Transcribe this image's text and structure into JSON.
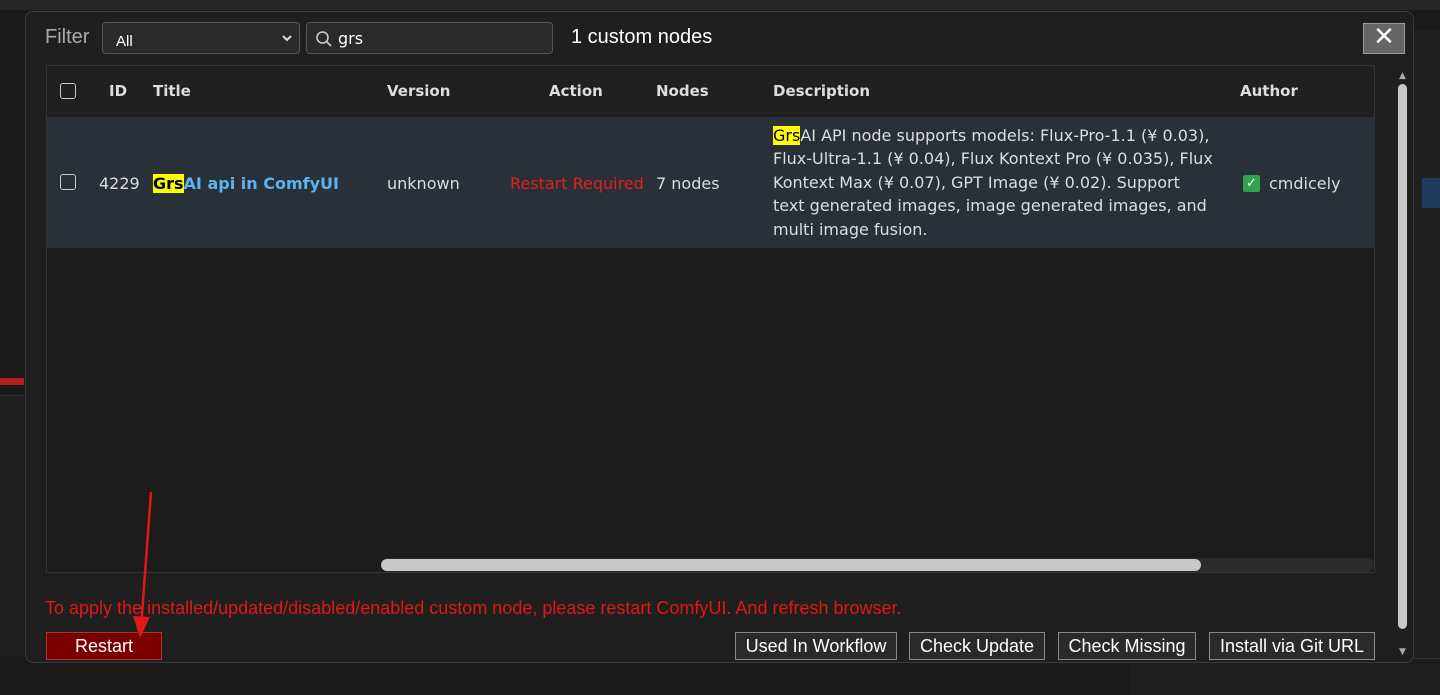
{
  "filter": {
    "label": "Filter",
    "selected": "All"
  },
  "search": {
    "value": "grs"
  },
  "result_count": "1 custom nodes",
  "close_label": "✕",
  "table": {
    "headers": {
      "id": "ID",
      "title": "Title",
      "version": "Version",
      "action": "Action",
      "nodes": "Nodes",
      "description": "Description",
      "author": "Author"
    },
    "rows": [
      {
        "id": "4229",
        "title_highlight": "Grs",
        "title_rest": "AI api in ComfyUI",
        "version": "unknown",
        "action": "Restart Required",
        "nodes": "7 nodes",
        "description_highlight": "Grs",
        "description_rest": "AI API node supports models: Flux-Pro-1.1 (¥ 0.03), Flux-Ultra-1.1 (¥ 0.04), Flux Kontext Pro (¥ 0.035), Flux Kontext Max (¥ 0.07), GPT Image (¥ 0.02). Support text generated images, image generated images, and multi image fusion.",
        "author": "cmdicely"
      }
    ]
  },
  "notice": "To apply the installed/updated/disabled/enabled custom node, please restart ComfyUI. And refresh browser.",
  "buttons": {
    "restart": "Restart",
    "used_in_workflow": "Used In Workflow",
    "check_update": "Check Update",
    "check_missing": "Check Missing",
    "install_git": "Install via Git URL"
  },
  "colors": {
    "highlight": "#ffff00",
    "title_link": "#5bb3f0",
    "restart_required": "#e02020",
    "notice": "#e01818",
    "restart_button": "#7a0000",
    "author_check": "#2ea44f"
  },
  "icons": {
    "search": "search-icon",
    "close": "close-icon",
    "chevron": "chevron-down-icon",
    "author_check": "check-icon",
    "annotation": "red-arrow-annotation"
  }
}
